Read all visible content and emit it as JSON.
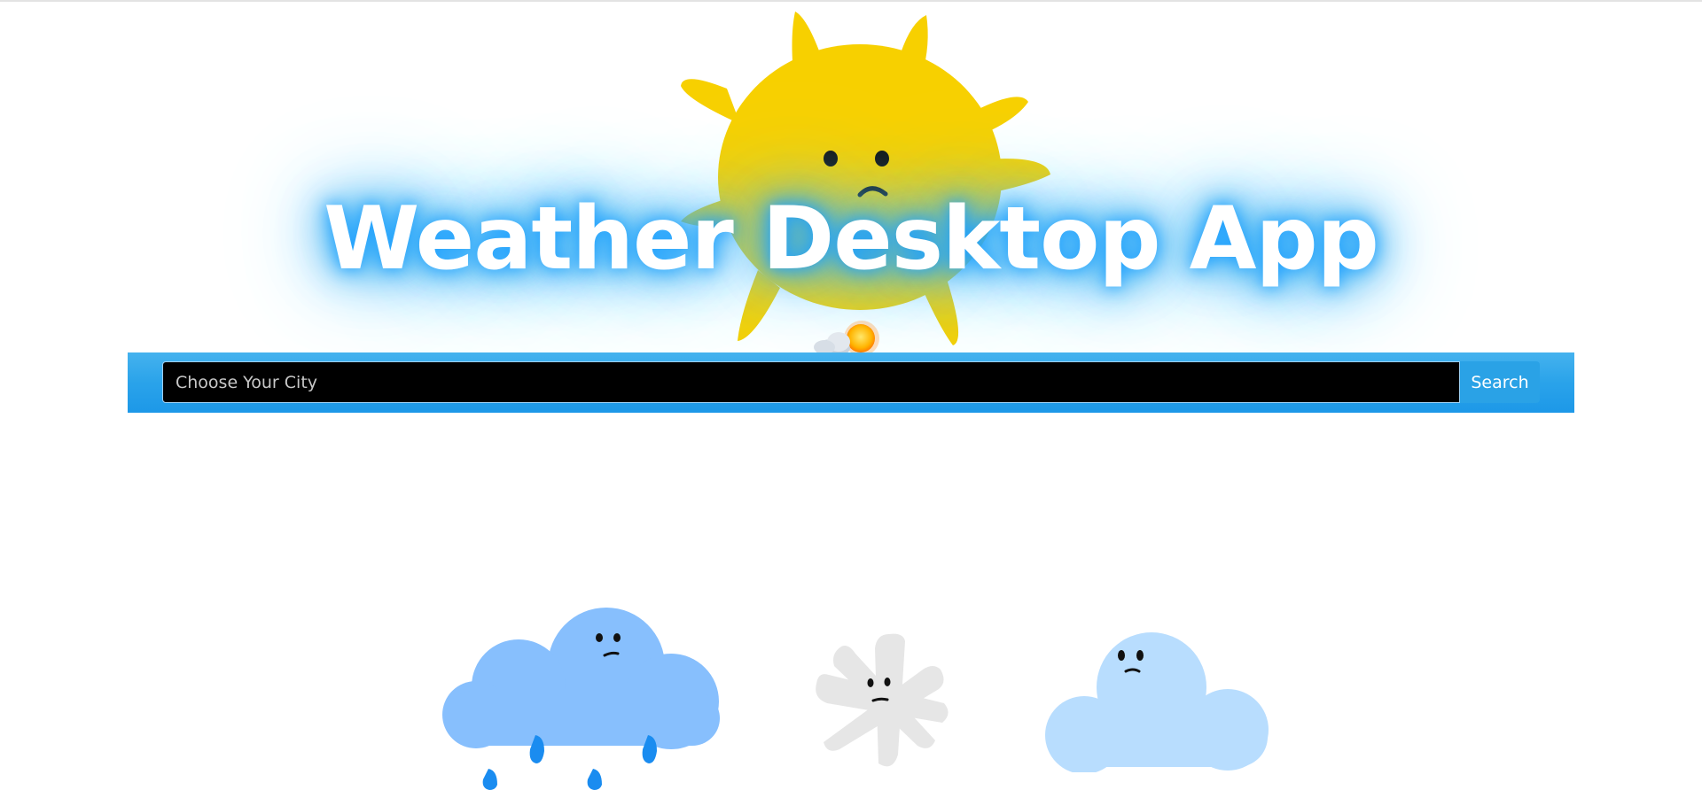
{
  "header": {
    "title": "Weather Desktop App"
  },
  "search": {
    "placeholder": "Choose Your City",
    "value": "",
    "button_label": "Search"
  },
  "icons": {
    "hero": "sad-sun-icon",
    "hero_badge": "sun-behind-cloud-icon",
    "row": [
      "sad-rain-cloud-icon",
      "sad-snowflake-icon",
      "sad-cloud-icon"
    ]
  },
  "colors": {
    "sun": "#f7d000",
    "title_glow": "#1ea0ff",
    "search_bar": "#2aa3ea",
    "input_bg": "#000000",
    "rain_cloud": "#87bffd",
    "rain_drop": "#1a8cf0",
    "snowflake": "#e6e6e6",
    "plain_cloud": "#b8ddfe"
  }
}
